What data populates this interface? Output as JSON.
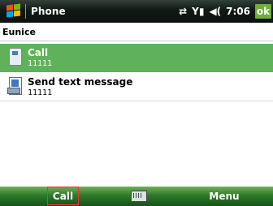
{
  "titlebar": {
    "app_title": "Phone",
    "clock": "7:06",
    "ok_label": "ok"
  },
  "contact": {
    "name": "Eunice"
  },
  "actions": [
    {
      "label": "Call",
      "number": "11111",
      "selected": true,
      "icon": "phone-icon"
    },
    {
      "label": "Send text message",
      "number": "11111",
      "selected": false,
      "icon": "sms-icon"
    }
  ],
  "softkeys": {
    "left": "Call",
    "right": "Menu"
  },
  "colors": {
    "selection": "#5fb25a",
    "titlebar": "#101915",
    "softbar": "#2f7a2a",
    "ok": "#6fae3a"
  }
}
